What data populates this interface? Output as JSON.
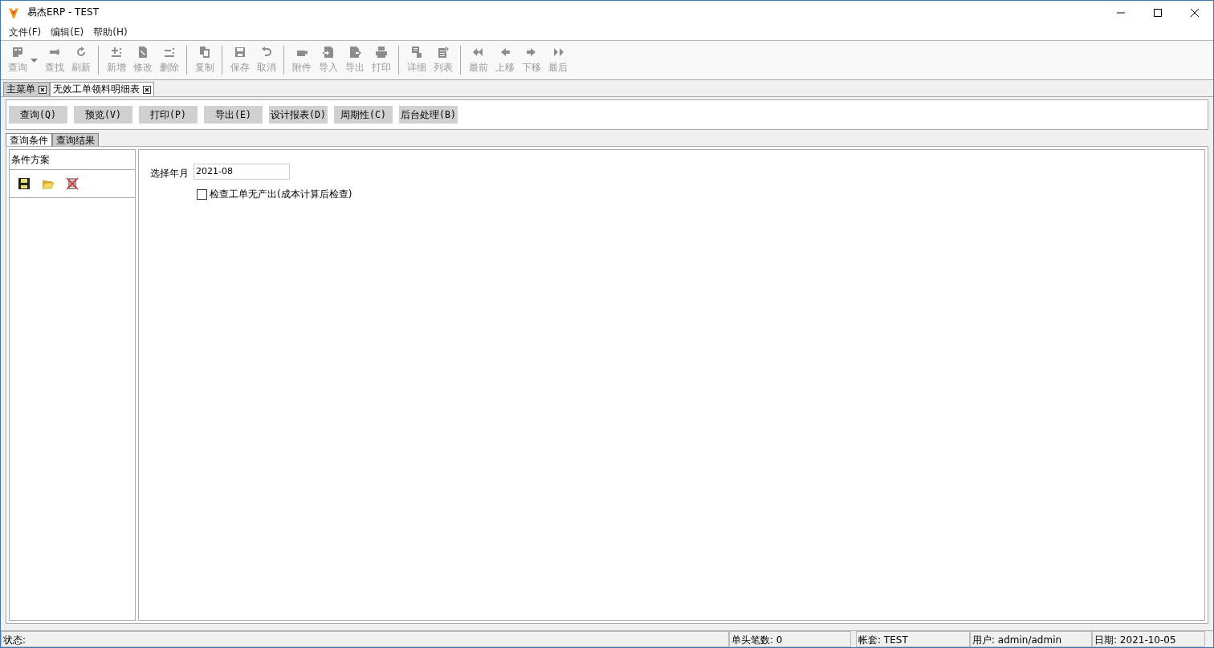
{
  "window": {
    "title": "易杰ERP - TEST"
  },
  "menu": [
    "文件(F)",
    "编辑(E)",
    "帮助(H)"
  ],
  "toolbar": [
    {
      "items": [
        {
          "label": "查询",
          "disabled": true,
          "dropdown": true
        },
        {
          "label": "查找",
          "disabled": true,
          "dropdown": false
        },
        {
          "label": "刷新",
          "disabled": true,
          "dropdown": false
        }
      ]
    },
    {
      "items": [
        {
          "label": "新增",
          "disabled": true,
          "dropdown": false
        },
        {
          "label": "修改",
          "disabled": true,
          "dropdown": false
        },
        {
          "label": "删除",
          "disabled": true,
          "dropdown": false
        }
      ]
    },
    {
      "items": [
        {
          "label": "复制",
          "disabled": true,
          "dropdown": false
        }
      ]
    },
    {
      "items": [
        {
          "label": "保存",
          "disabled": true,
          "dropdown": false
        },
        {
          "label": "取消",
          "disabled": true,
          "dropdown": false
        }
      ]
    },
    {
      "items": [
        {
          "label": "附件",
          "disabled": true,
          "dropdown": false
        },
        {
          "label": "导入",
          "disabled": true,
          "dropdown": false
        },
        {
          "label": "导出",
          "disabled": true,
          "dropdown": false
        },
        {
          "label": "打印",
          "disabled": true,
          "dropdown": false
        }
      ]
    },
    {
      "items": [
        {
          "label": "详细",
          "disabled": true,
          "dropdown": false
        },
        {
          "label": "列表",
          "disabled": true,
          "dropdown": false
        }
      ]
    },
    {
      "items": [
        {
          "label": "最前",
          "disabled": true,
          "dropdown": false
        },
        {
          "label": "上移",
          "disabled": true,
          "dropdown": false
        },
        {
          "label": "下移",
          "disabled": true,
          "dropdown": false
        },
        {
          "label": "最后",
          "disabled": true,
          "dropdown": false
        }
      ]
    }
  ],
  "doc_tabs": [
    {
      "label": "主菜单",
      "selected": false
    },
    {
      "label": "无效工单领料明细表",
      "selected": true
    }
  ],
  "actions": [
    "查询(Q)",
    "预览(V)",
    "打印(P)",
    "导出(E)",
    "设计报表(D)",
    "周期性(C)",
    "后台处理(B)"
  ],
  "sub_tabs": [
    {
      "label": "查询条件",
      "selected": true
    },
    {
      "label": "查询结果",
      "selected": false
    }
  ],
  "scheme_panel": {
    "title": "条件方案"
  },
  "form": {
    "month_label": "选择年月",
    "month_value": "2021-08",
    "check_label": "检查工单无产出(成本计算后检查)",
    "checked": false
  },
  "status_bar": [
    "状态:",
    "单头笔数: 0",
    "帐套: TEST",
    "用户: admin/admin",
    "日期: 2021-10-05"
  ]
}
